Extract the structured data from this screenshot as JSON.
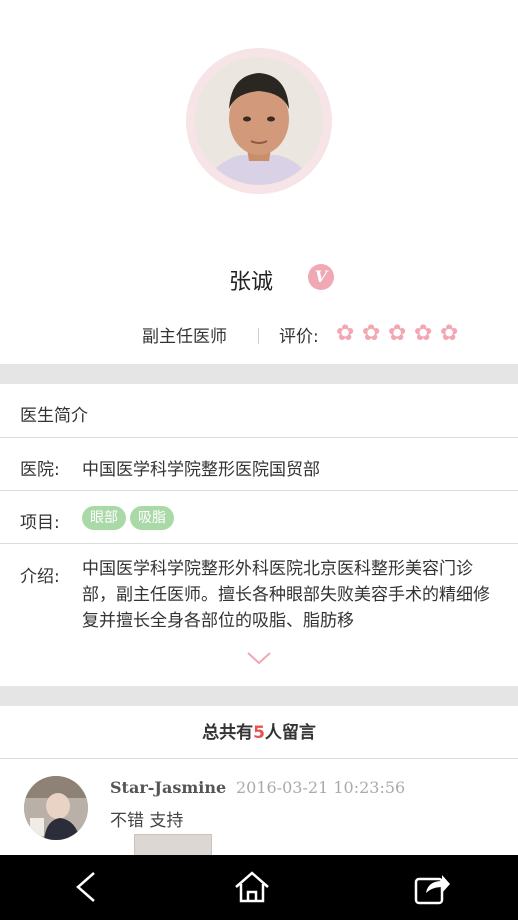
{
  "doctor": {
    "name": "张诚",
    "badge": "V",
    "title": "副主任医师",
    "rating_label": "评价:",
    "rating": 5,
    "rating_max": 5
  },
  "section": {
    "title": "医生简介"
  },
  "hospital": {
    "label": "医院:",
    "value": "中国医学科学院整形医院国贸部"
  },
  "project": {
    "label": "项目:",
    "tags": [
      "眼部",
      "吸脂"
    ]
  },
  "intro": {
    "label": "介绍:",
    "text": "中国医学科学院整形外科医院北京医科整形美容门诊部，副主任医师。擅长各种眼部失败美容手术的精细修复并擅长全身各部位的吸脂、脂肪移"
  },
  "comments": {
    "prefix": "总共有",
    "count": "5",
    "suffix": "人留言",
    "items": [
      {
        "user": "Star-Jasmine",
        "time": "2016-03-21 10:23:56",
        "text": "不错 支持"
      }
    ]
  },
  "icons": {
    "back": "back-arrow-icon",
    "home": "home-icon",
    "share": "share-icon",
    "expand": "chevron-down-icon",
    "star": "flower-star-icon"
  },
  "colors": {
    "accent_pink": "#f2a7b3",
    "tag_green": "#a9d9a7",
    "count_red": "#e8534e"
  }
}
